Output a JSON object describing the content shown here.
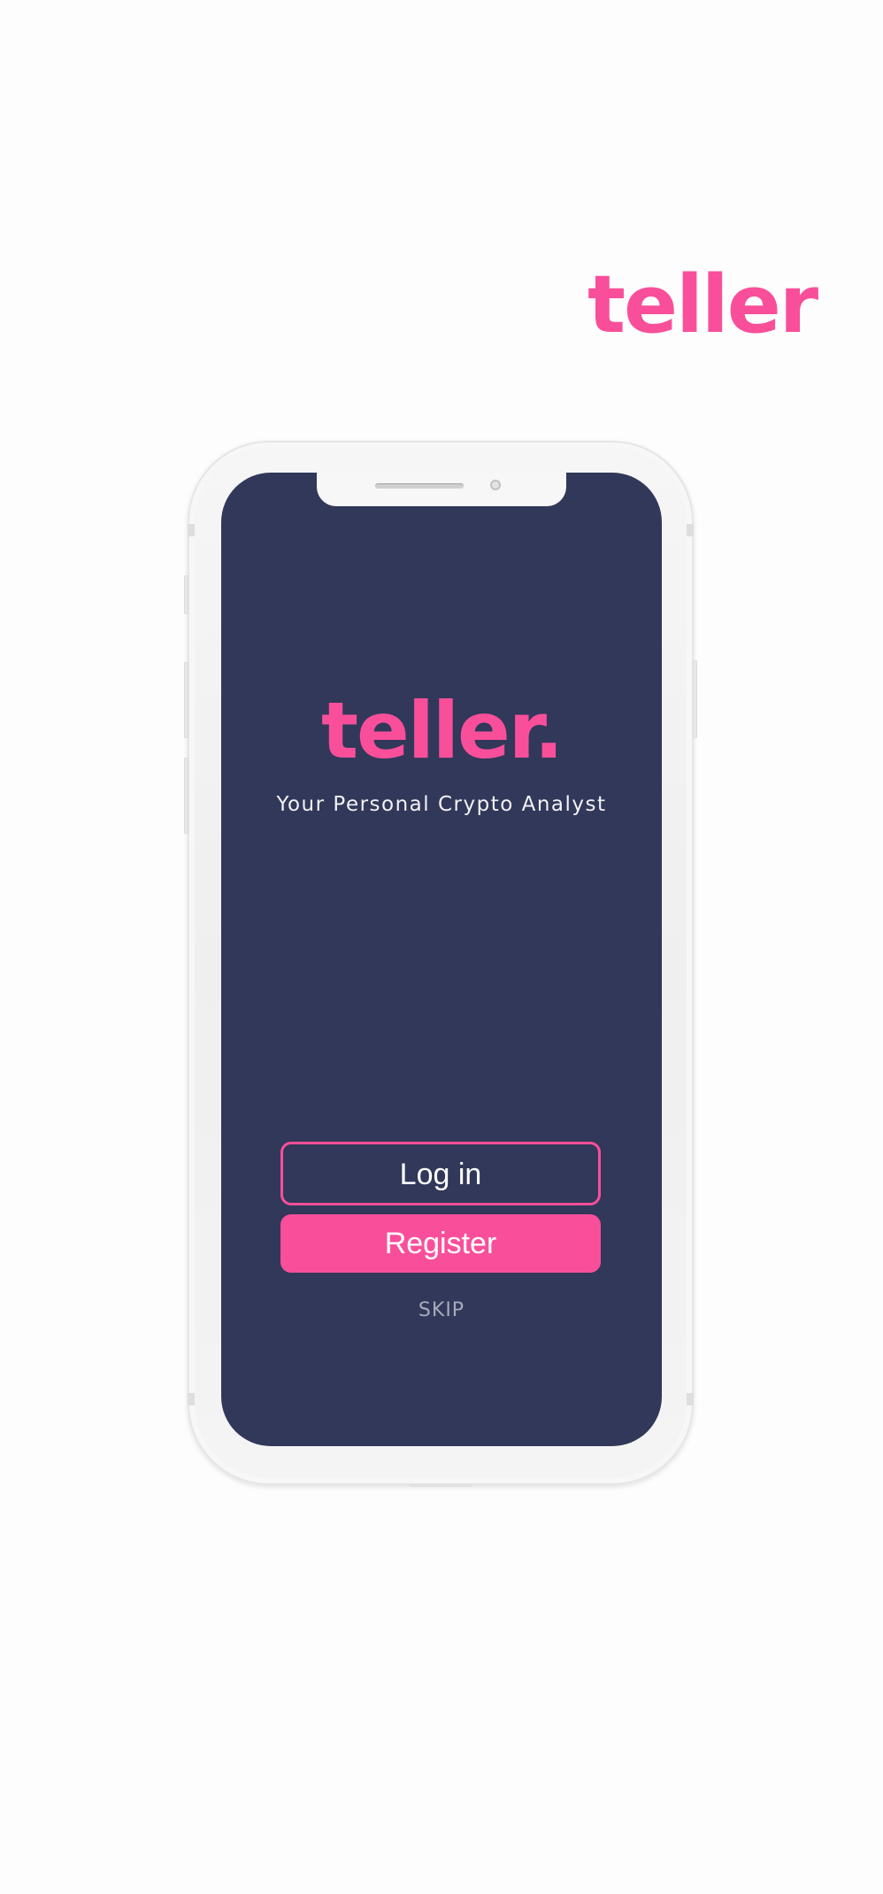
{
  "brand": {
    "top_wordmark": "teller",
    "accent_color": "#f94f9a"
  },
  "device": {
    "frame": "smartphone-mockup",
    "screen_background": "#313859"
  },
  "screen": {
    "logo": "teller.",
    "tagline": "Your Personal Crypto Analyst",
    "login_label": "Log in",
    "register_label": "Register",
    "skip_label": "SKIP"
  }
}
